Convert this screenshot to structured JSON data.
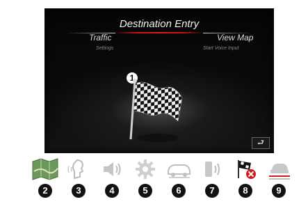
{
  "screen": {
    "title": "Destination Entry",
    "left_label": "Traffic",
    "left_sub": "Settings",
    "right_label": "View Map",
    "right_sub": "Start Voice Input",
    "callout": "1",
    "back_symbol": "⮐"
  },
  "toolbar": {
    "items": [
      {
        "num": "2",
        "icon": "map-icon"
      },
      {
        "num": "3",
        "icon": "voice-control-icon"
      },
      {
        "num": "4",
        "icon": "volume-icon"
      },
      {
        "num": "5",
        "icon": "settings-gear-icon"
      },
      {
        "num": "6",
        "icon": "vehicle-icon"
      },
      {
        "num": "7",
        "icon": "phone-icon"
      },
      {
        "num": "8",
        "icon": "cancel-route-icon"
      },
      {
        "num": "9",
        "icon": "lane-guidance-icon"
      }
    ]
  }
}
